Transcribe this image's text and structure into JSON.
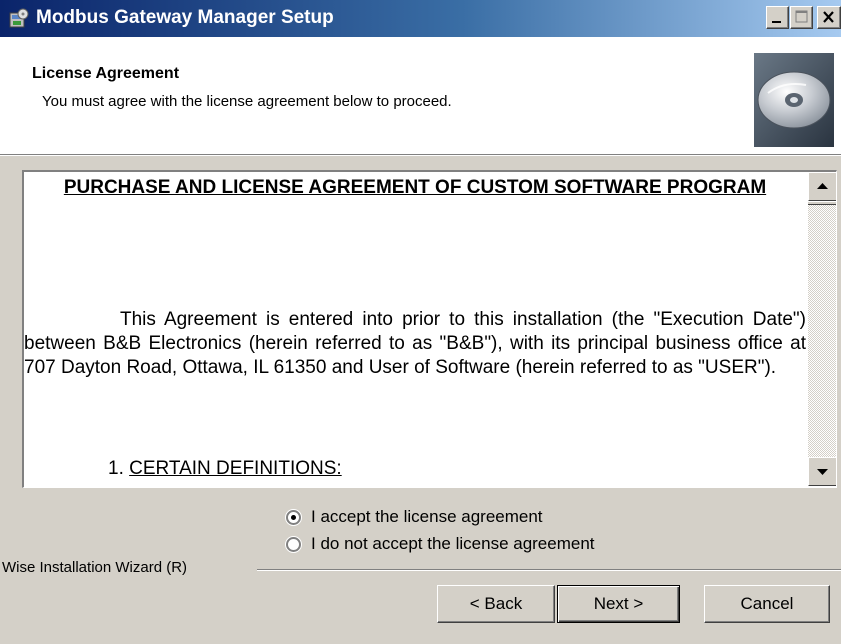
{
  "window": {
    "title": "Modbus Gateway Manager Setup"
  },
  "header": {
    "title": "License Agreement",
    "subtitle": "You must agree with the license agreement below to proceed.",
    "icon": "cd-disc-icon"
  },
  "license": {
    "title": "PURCHASE AND LICENSE AGREEMENT OF CUSTOM SOFTWARE PROGRAM",
    "paragraph": "This Agreement is entered into prior to this installation (the \"Execution Date\") between B&B Electronics (herein referred to as \"B&B\"), with its principal business office at 707 Dayton Road, Ottawa, IL 61350 and User of Software (herein referred to as \"USER\").",
    "section_number": "1.",
    "section_title": "CERTAIN DEFINITIONS:"
  },
  "options": {
    "accept_label": "I accept the license agreement",
    "decline_label": "I do not accept the license agreement",
    "selected": "accept"
  },
  "footer": {
    "brand": "Wise Installation Wizard (R)",
    "back_label": "< Back",
    "next_label": "Next >",
    "cancel_label": "Cancel"
  },
  "colors": {
    "titlebar_start": "#0a246a",
    "titlebar_end": "#a6caf0",
    "dialog_face": "#d4d0c8"
  }
}
